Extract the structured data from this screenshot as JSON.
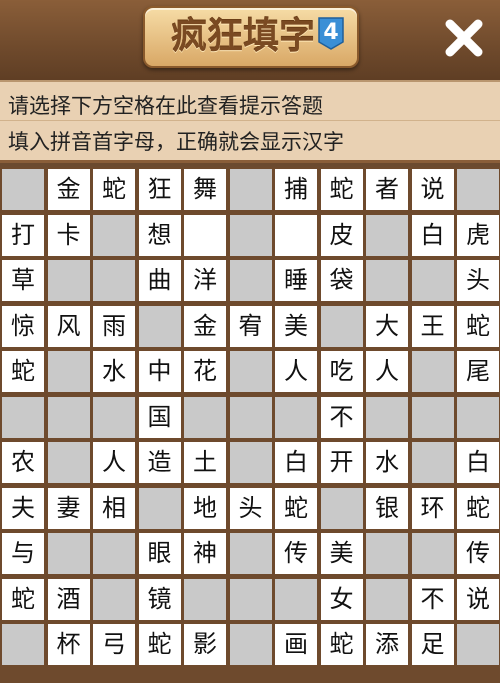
{
  "header": {
    "title": "疯狂填字",
    "badge": "4"
  },
  "hint": {
    "line1": "请选择下方空格在此查看提示答题",
    "line2": "填入拼音首字母，正确就会显示汉字"
  },
  "icons": {
    "close": "close-x-icon",
    "badge": "level-badge-icon"
  },
  "colors": {
    "wood": "#6b4a2f",
    "hint_bg": "#e9d1b3",
    "empty_cell": "#c9c9c9",
    "filled_cell": "#ffffff",
    "badge_blue": "#3a8fd6"
  },
  "grid": {
    "rows": [
      [
        "#",
        "金",
        "蛇",
        "狂",
        "舞",
        "#",
        "捕",
        "蛇",
        "者",
        "说",
        "#"
      ],
      [
        "打",
        "卡",
        "#",
        "想",
        "",
        "#",
        "",
        "皮",
        "#",
        "白",
        "虎"
      ],
      [
        "草",
        "#",
        "#",
        "曲",
        "洋",
        "#",
        "睡",
        "袋",
        "#",
        "#",
        "头"
      ],
      [
        "惊",
        "风",
        "雨",
        "#",
        "金",
        "宥",
        "美",
        "#",
        "大",
        "王",
        "蛇"
      ],
      [
        "蛇",
        "#",
        "水",
        "中",
        "花",
        "#",
        "人",
        "吃",
        "人",
        "#",
        "尾"
      ],
      [
        "#",
        "#",
        "#",
        "国",
        "#",
        "#",
        "#",
        "不",
        "#",
        "#",
        "#"
      ],
      [
        "农",
        "#",
        "人",
        "造",
        "土",
        "#",
        "白",
        "开",
        "水",
        "#",
        "白"
      ],
      [
        "夫",
        "妻",
        "相",
        "#",
        "地",
        "头",
        "蛇",
        "#",
        "银",
        "环",
        "蛇"
      ],
      [
        "与",
        "#",
        "#",
        "眼",
        "神",
        "#",
        "传",
        "美",
        "#",
        "#",
        "传"
      ],
      [
        "蛇",
        "酒",
        "#",
        "镜",
        "#",
        "#",
        "#",
        "女",
        "#",
        "不",
        "说"
      ],
      [
        "#",
        "杯",
        "弓",
        "蛇",
        "影",
        "#",
        "画",
        "蛇",
        "添",
        "足",
        "#"
      ]
    ]
  }
}
